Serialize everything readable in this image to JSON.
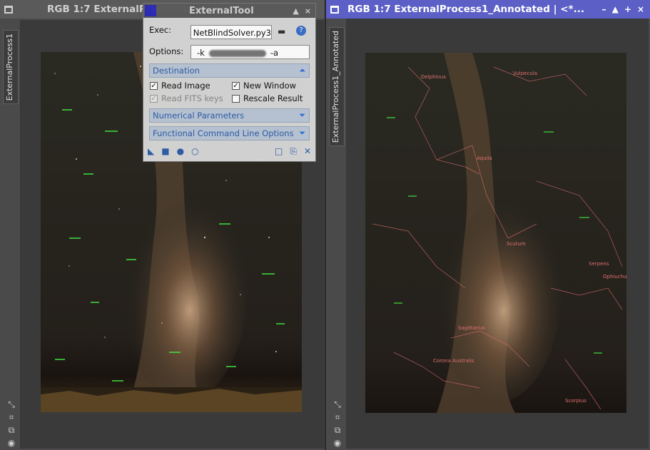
{
  "left_window": {
    "title": "RGB 1:7 ExternalProcess1",
    "tab_label": "ExternalProcess1",
    "controls": [
      "–",
      "+",
      "×"
    ]
  },
  "right_window": {
    "title": "RGB 1:7 ExternalProcess1_Annotated | <*...",
    "tab_label": "ExternalProcess1_Annotated",
    "controls": [
      "–",
      "▲",
      "+",
      "×"
    ],
    "annotations": [
      "Delphinus",
      "Vulpecula",
      "Aquila",
      "Scutum",
      "Serpens",
      "Ophiuchus",
      "Sagittarius",
      "Corona Australis",
      "Scorpius"
    ]
  },
  "dialog": {
    "title": "ExternalTool",
    "exec_label": "Exec:",
    "exec_value": "NetBlindSolver.py3",
    "options_label": "Options:",
    "options_prefix": "-k",
    "options_suffix": "-a",
    "sections": {
      "destination": "Destination",
      "numerical": "Numerical Parameters",
      "functional": "Functional Command Line Options"
    },
    "checkboxes": {
      "read_image": "Read Image",
      "new_window": "New Window",
      "read_fits": "Read FITS keys",
      "rescale": "Rescale Result"
    }
  },
  "colors": {
    "active_title": "#5b5fc6",
    "section_text": "#2d5da8",
    "annotation_red": "#e07070",
    "star_label_green": "#40e040"
  }
}
